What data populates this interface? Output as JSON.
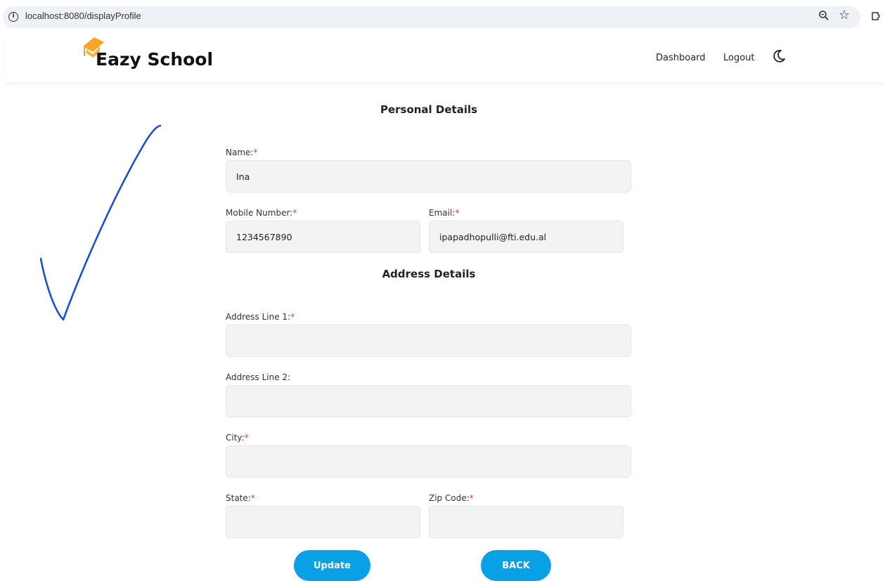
{
  "browser": {
    "url": "localhost:8080/displayProfile",
    "info_icon": "i"
  },
  "header": {
    "brand": "Eazy School",
    "nav": [
      "Dashboard",
      "Logout"
    ],
    "icons": [
      "graduation-cap-icon",
      "moon-icon"
    ]
  },
  "personal": {
    "title": "Personal Details",
    "name_label": "Name:",
    "name_value": "Ina",
    "mobile_label": "Mobile Number:",
    "mobile_value": "1234567890",
    "email_label": "Email:",
    "email_value": "ipapadhopulli@fti.edu.al"
  },
  "address": {
    "title": "Address Details",
    "line1_label": "Address Line 1:",
    "line1_value": "",
    "line2_label": "Address Line 2:",
    "line2_value": "",
    "city_label": "City:",
    "city_value": "",
    "state_label": "State:",
    "state_value": "",
    "zip_label": "Zip Code:",
    "zip_value": ""
  },
  "required_mark": "*",
  "buttons": {
    "update": "Update",
    "back": "BACK"
  },
  "colors": {
    "accent": "#0aa0e6",
    "required": "#d9363e",
    "checkmark": "#1a4fd6",
    "logo": "#f5a623"
  }
}
